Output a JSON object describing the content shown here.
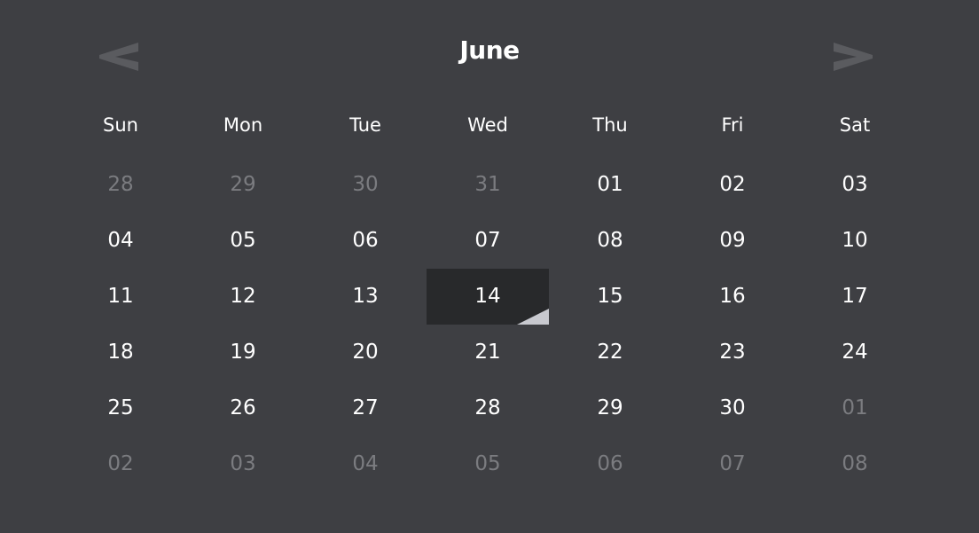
{
  "calendar": {
    "month": "June",
    "prev_icon": "chevron-left-icon",
    "next_icon": "chevron-right-icon",
    "weekdays": [
      "Sun",
      "Mon",
      "Tue",
      "Wed",
      "Thu",
      "Fri",
      "Sat"
    ],
    "weeks": [
      [
        {
          "label": "28",
          "in_month": false
        },
        {
          "label": "29",
          "in_month": false
        },
        {
          "label": "30",
          "in_month": false
        },
        {
          "label": "31",
          "in_month": false
        },
        {
          "label": "01",
          "in_month": true
        },
        {
          "label": "02",
          "in_month": true
        },
        {
          "label": "03",
          "in_month": true
        }
      ],
      [
        {
          "label": "04",
          "in_month": true
        },
        {
          "label": "05",
          "in_month": true
        },
        {
          "label": "06",
          "in_month": true
        },
        {
          "label": "07",
          "in_month": true
        },
        {
          "label": "08",
          "in_month": true
        },
        {
          "label": "09",
          "in_month": true
        },
        {
          "label": "10",
          "in_month": true
        }
      ],
      [
        {
          "label": "11",
          "in_month": true
        },
        {
          "label": "12",
          "in_month": true
        },
        {
          "label": "13",
          "in_month": true
        },
        {
          "label": "14",
          "in_month": true,
          "selected": true
        },
        {
          "label": "15",
          "in_month": true
        },
        {
          "label": "16",
          "in_month": true
        },
        {
          "label": "17",
          "in_month": true
        }
      ],
      [
        {
          "label": "18",
          "in_month": true
        },
        {
          "label": "19",
          "in_month": true
        },
        {
          "label": "20",
          "in_month": true
        },
        {
          "label": "21",
          "in_month": true
        },
        {
          "label": "22",
          "in_month": true
        },
        {
          "label": "23",
          "in_month": true
        },
        {
          "label": "24",
          "in_month": true
        }
      ],
      [
        {
          "label": "25",
          "in_month": true
        },
        {
          "label": "26",
          "in_month": true
        },
        {
          "label": "27",
          "in_month": true
        },
        {
          "label": "28",
          "in_month": true
        },
        {
          "label": "29",
          "in_month": true
        },
        {
          "label": "30",
          "in_month": true
        },
        {
          "label": "01",
          "in_month": false
        }
      ],
      [
        {
          "label": "02",
          "in_month": false
        },
        {
          "label": "03",
          "in_month": false
        },
        {
          "label": "04",
          "in_month": false
        },
        {
          "label": "05",
          "in_month": false
        },
        {
          "label": "06",
          "in_month": false
        },
        {
          "label": "07",
          "in_month": false
        },
        {
          "label": "08",
          "in_month": false
        }
      ]
    ]
  },
  "colors": {
    "background": "#3e3f43",
    "text": "#ffffff",
    "muted_text": "#7b7c80",
    "selected_bg": "#28292b",
    "selected_corner": "#c8c9cf",
    "nav_arrow": "#5a5b5f"
  }
}
